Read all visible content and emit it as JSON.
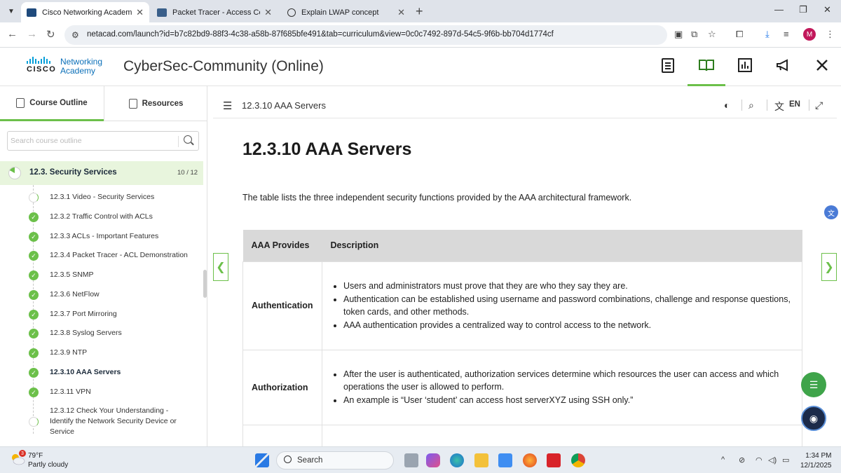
{
  "browser": {
    "tabs": [
      {
        "title": "Cisco Networking Academy: Cy",
        "active": true
      },
      {
        "title": "Packet Tracer - Access Control L",
        "active": false
      },
      {
        "title": "Explain LWAP concept",
        "active": false
      }
    ],
    "url": "netacad.com/launch?id=b7c82bd9-88f3-4c38-a58b-87f685bfe491&tab=curriculum&view=0c0c7492-897d-54c5-9f6b-bb704d1774cf",
    "profile_initial": "M"
  },
  "header": {
    "logo_word": "CISCO",
    "brand_line1": "Networking",
    "brand_line2": "Academy",
    "course_title": "CyberSec-Community (Online)"
  },
  "sidebar": {
    "tabs": [
      {
        "label": "Course Outline",
        "active": true
      },
      {
        "label": "Resources",
        "active": false
      }
    ],
    "search_placeholder": "Search course outline",
    "section": {
      "label": "12.3. Security Services",
      "progress_text": "10 / 12",
      "progress": 0.83
    },
    "items": [
      {
        "label": "12.3.1 Video - Security Services",
        "status": "partial"
      },
      {
        "label": "12.3.2 Traffic Control with ACLs",
        "status": "complete"
      },
      {
        "label": "12.3.3 ACLs - Important Features",
        "status": "complete"
      },
      {
        "label": "12.3.4 Packet Tracer - ACL Demonstration",
        "status": "complete"
      },
      {
        "label": "12.3.5 SNMP",
        "status": "complete"
      },
      {
        "label": "12.3.6 NetFlow",
        "status": "complete"
      },
      {
        "label": "12.3.7 Port Mirroring",
        "status": "complete"
      },
      {
        "label": "12.3.8 Syslog Servers",
        "status": "complete"
      },
      {
        "label": "12.3.9 NTP",
        "status": "complete"
      },
      {
        "label": "12.3.10 AAA Servers",
        "status": "complete",
        "current": true
      },
      {
        "label": "12.3.11 VPN",
        "status": "complete"
      },
      {
        "label": "12.3.12 Check Your Understanding - Identify the Network Security Device or Service",
        "status": "partial"
      }
    ]
  },
  "content": {
    "breadcrumb": "12.3.10 AAA Servers",
    "language": "EN",
    "page_title": "12.3.10 AAA Servers",
    "intro": "The table lists the three independent security functions provided by the AAA architectural framework.",
    "table": {
      "headers": [
        "AAA Provides",
        "Description"
      ],
      "rows": [
        {
          "term": "Authentication",
          "bullets": [
            "Users and administrators must prove that they are who they say they are.",
            "Authentication can be established using username and password combinations, challenge and response questions, token cards, and other methods.",
            "AAA authentication provides a centralized way to control access to the network."
          ]
        },
        {
          "term": "Authorization",
          "bullets": [
            "After the user is authenticated, authorization services determine which resources the user can access and which operations the user is allowed to perform.",
            "An example is “User ‘student’ can access host serverXYZ using SSH only.”"
          ]
        }
      ]
    }
  },
  "taskbar": {
    "weather_temp": "79°F",
    "weather_condition": "Partly cloudy",
    "weather_badge": "3",
    "search_label": "Search",
    "time": "1:34 PM",
    "date": "12/1/2025"
  },
  "colors": {
    "accent": "#6cc04a",
    "cisco_blue": "#049fd9",
    "link_blue": "#0a6fb8"
  }
}
